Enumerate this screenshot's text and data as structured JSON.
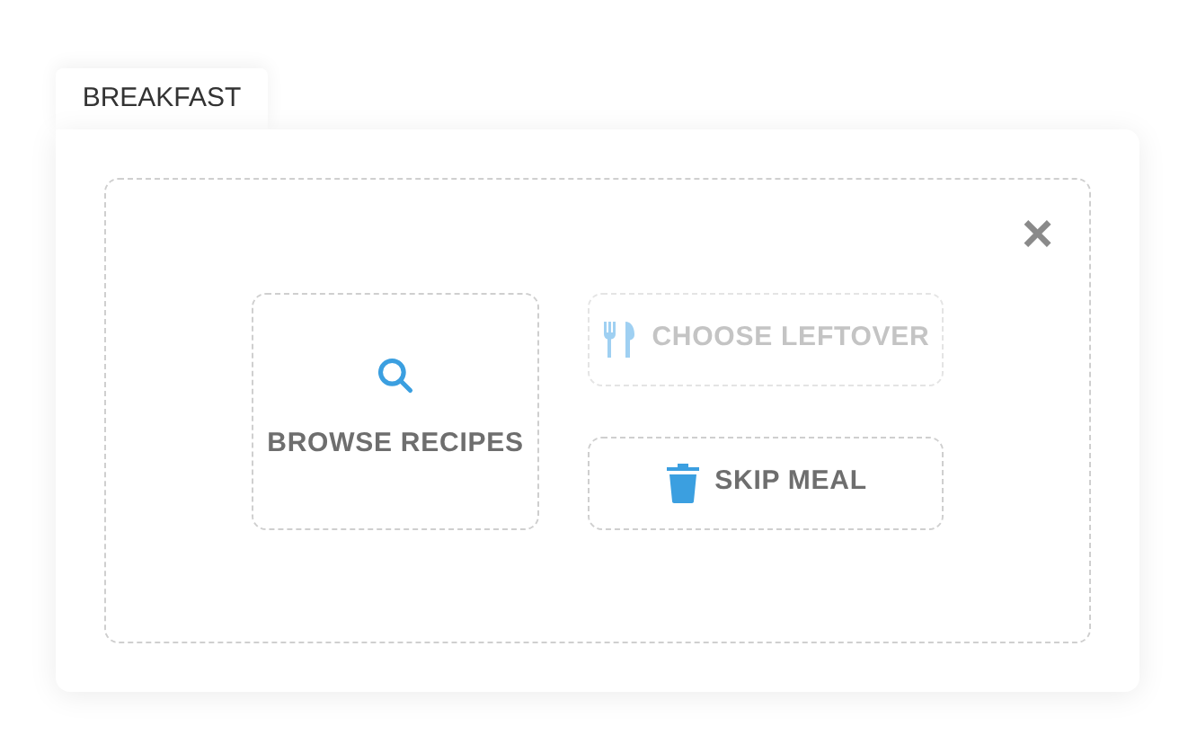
{
  "tab": {
    "label": "BREAKFAST"
  },
  "close": {
    "label": "×"
  },
  "actions": [
    {
      "kind": "browse",
      "label": "BROWSE RECIPES",
      "disabled": false
    },
    {
      "kind": "leftover",
      "label": "CHOOSE LEFTOVER",
      "disabled": true
    },
    {
      "kind": "skip",
      "label": "SKIP MEAL",
      "disabled": false
    }
  ]
}
